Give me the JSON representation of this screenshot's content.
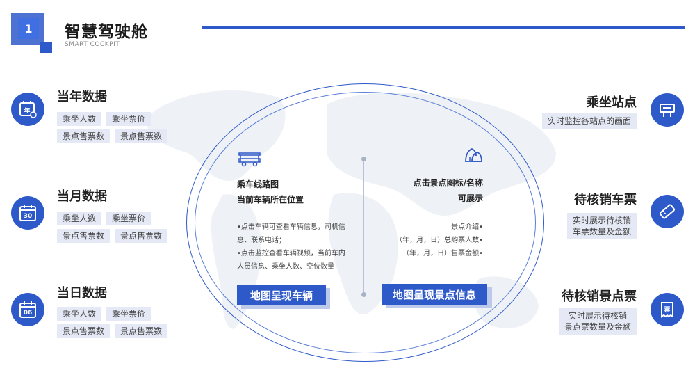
{
  "header": {
    "number": "1",
    "title": "智慧驾驶舱",
    "subtitle": "SMART COCKPIT"
  },
  "left": [
    {
      "title": "当年数据",
      "icon": "calendar-year-icon",
      "icon_text": "年",
      "tags": [
        "乘坐人数",
        "乘坐票价",
        "景点售票数",
        "景点售票数"
      ]
    },
    {
      "title": "当月数据",
      "icon": "calendar-month-icon",
      "icon_text": "30",
      "tags": [
        "乘坐人数",
        "乘坐票价",
        "景点售票数",
        "景点售票数"
      ]
    },
    {
      "title": "当日数据",
      "icon": "calendar-day-icon",
      "icon_text": "06",
      "tags": [
        "乘坐人数",
        "乘坐票价",
        "景点售票数",
        "景点售票数"
      ]
    }
  ],
  "right": [
    {
      "title": "乘坐站点",
      "icon": "station-sign-icon",
      "desc_lines": [
        "实时监控各站点的画面"
      ]
    },
    {
      "title": "待核销车票",
      "icon": "ticket-icon",
      "desc_lines": [
        "实时展示待核销",
        "车票数量及金额"
      ]
    },
    {
      "title": "待核销景点票",
      "icon": "receipt-icon",
      "icon_text": "票",
      "desc_lines": [
        "实时展示待核销",
        "景点票数量及金额"
      ]
    }
  ],
  "center": {
    "left_block": {
      "icon": "tour-cart-icon",
      "title_lines": [
        "乘车线路图",
        "当前车辆所在位置"
      ],
      "body_lines": [
        "•点击车辆可查看车辆信息，司机信",
        "息、联系电话；",
        "•点击监控查看车辆视频，当前车内",
        "人员信息、乘坐人数、空位数量"
      ],
      "button": "地图呈现车辆"
    },
    "right_block": {
      "icon": "scenic-spot-icon",
      "title_lines": [
        "点击景点图标/名称",
        "可展示"
      ],
      "body_lines": [
        "景点介绍•",
        "（年，月，日）总购票人数•",
        "（年，月，日）售票金额•"
      ],
      "button": "地图呈现景点信息"
    }
  },
  "colors": {
    "primary": "#2e59c9",
    "tag_bg": "#e4e9f5",
    "map": "#eef1f5"
  }
}
